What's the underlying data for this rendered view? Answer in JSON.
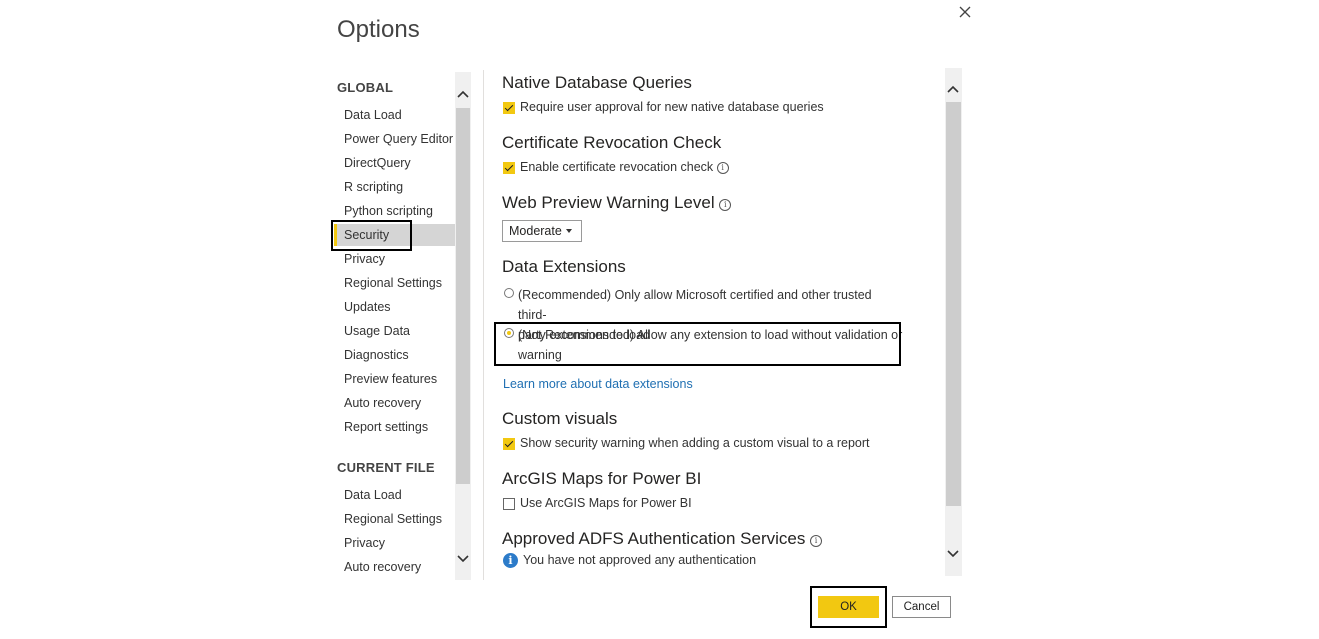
{
  "dialog": {
    "title": "Options",
    "close_icon": "close-icon"
  },
  "nav": {
    "global_header": "GLOBAL",
    "global_items": [
      {
        "label": "Data Load"
      },
      {
        "label": "Power Query Editor"
      },
      {
        "label": "DirectQuery"
      },
      {
        "label": "R scripting"
      },
      {
        "label": "Python scripting"
      },
      {
        "label": "Security",
        "selected": true
      },
      {
        "label": "Privacy"
      },
      {
        "label": "Regional Settings"
      },
      {
        "label": "Updates"
      },
      {
        "label": "Usage Data"
      },
      {
        "label": "Diagnostics"
      },
      {
        "label": "Preview features"
      },
      {
        "label": "Auto recovery"
      },
      {
        "label": "Report settings"
      }
    ],
    "current_file_header": "CURRENT FILE",
    "current_file_items": [
      {
        "label": "Data Load"
      },
      {
        "label": "Regional Settings"
      },
      {
        "label": "Privacy"
      },
      {
        "label": "Auto recovery"
      }
    ]
  },
  "content": {
    "native_db": {
      "title": "Native Database Queries",
      "option": "Require user approval for new native database queries",
      "checked": true
    },
    "cert": {
      "title": "Certificate Revocation Check",
      "option": "Enable certificate revocation check",
      "checked": true
    },
    "web_preview": {
      "title": "Web Preview Warning Level",
      "selected": "Moderate"
    },
    "data_ext": {
      "title": "Data Extensions",
      "option1_line1": "(Recommended) Only allow Microsoft certified and other trusted third-",
      "option1_line2": "party extensions to load",
      "option2_line1": "(Not Recommended) Allow any extension to load without validation or",
      "option2_line2": "warning",
      "selected_option": 2,
      "learn_more": "Learn more about data extensions"
    },
    "custom_visuals": {
      "title": "Custom visuals",
      "option": "Show security warning when adding a custom visual to a report",
      "checked": true
    },
    "arcgis": {
      "title": "ArcGIS Maps for Power BI",
      "option": "Use ArcGIS Maps for Power BI",
      "checked": false
    },
    "adfs": {
      "title": "Approved ADFS Authentication Services",
      "message": "You have not approved any authentication"
    }
  },
  "buttons": {
    "ok": "OK",
    "cancel": "Cancel"
  },
  "colors": {
    "accent": "#f2c811",
    "link": "#1f6fb2",
    "selected_nav": "#d5d5d5"
  }
}
